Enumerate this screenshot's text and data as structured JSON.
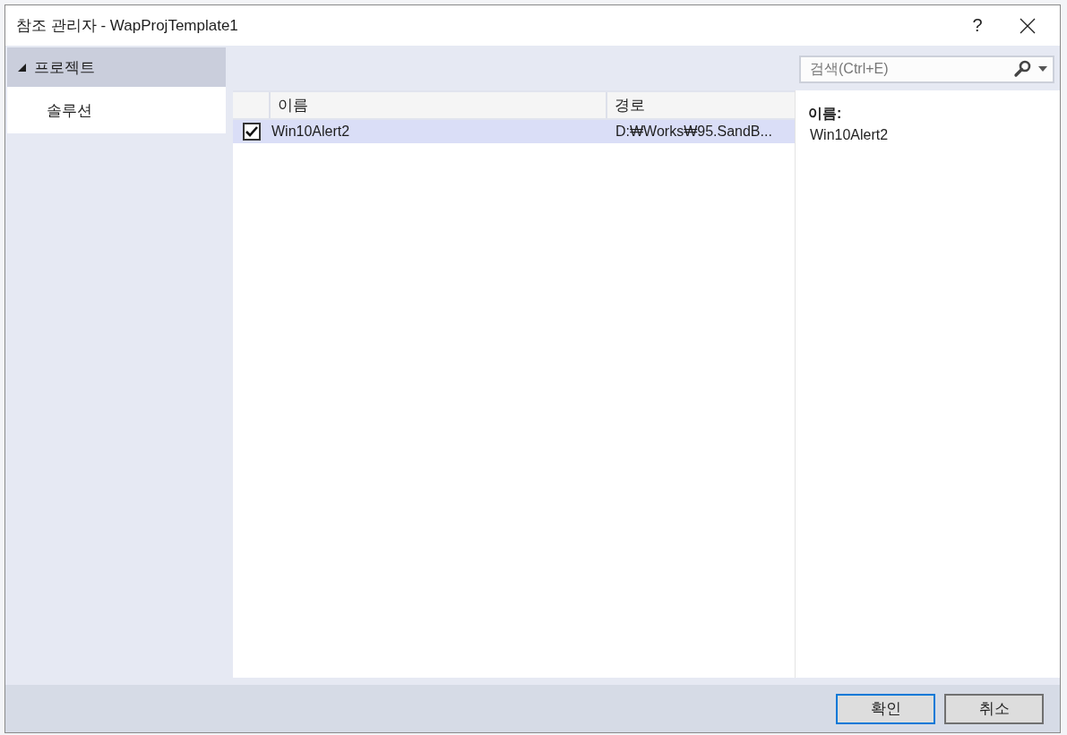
{
  "window": {
    "title": "참조 관리자 - WapProjTemplate1",
    "help": "?"
  },
  "sidebar": {
    "items": [
      {
        "label": "프로젝트",
        "selected": true,
        "expanded": true
      },
      {
        "label": "솔루션",
        "selected": false
      }
    ]
  },
  "search": {
    "placeholder": "검색(Ctrl+E)"
  },
  "table": {
    "columns": [
      "이름",
      "경로"
    ],
    "rows": [
      {
        "checked": true,
        "selected": true,
        "name": "Win10Alert2",
        "path": "D:₩Works₩95.SandB..."
      }
    ]
  },
  "details": {
    "label": "이름:",
    "value": "Win10Alert2"
  },
  "buttons": [
    {
      "label": "확인",
      "default": true
    },
    {
      "label": "취소",
      "default": false
    }
  ]
}
